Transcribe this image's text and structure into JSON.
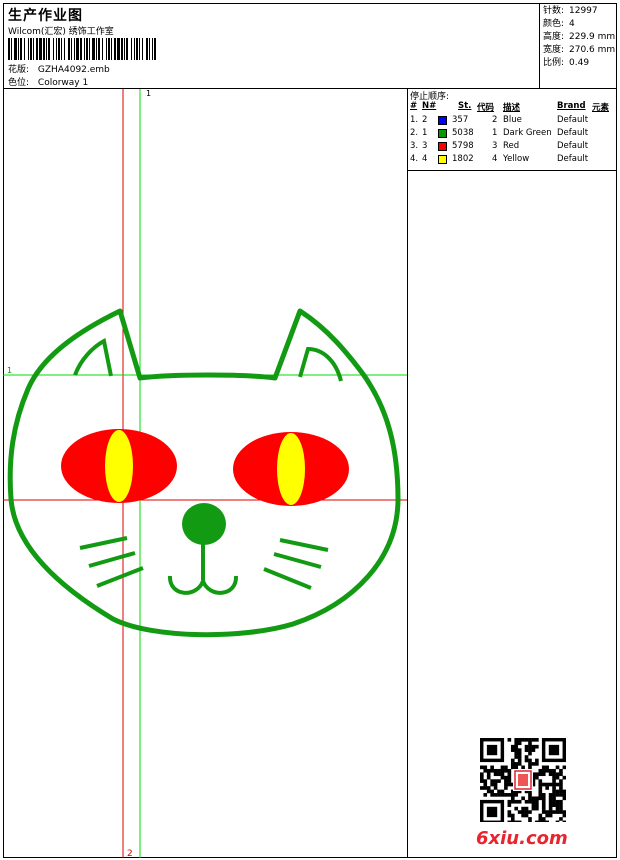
{
  "header": {
    "title": "生产作业图",
    "subtitle": "Wilcom(汇宏) 绣饰工作室",
    "design_label": "花版:",
    "design_value": "GZHA4092.emb",
    "colorway_label": "色位:",
    "colorway_value": "Colorway 1"
  },
  "stats": {
    "stitches_label": "针数:",
    "stitches_value": "12997",
    "colors_label": "颜色:",
    "colors_value": "4",
    "height_label": "高度:",
    "height_value": "229.9 mm",
    "width_label": "宽度:",
    "width_value": "270.6 mm",
    "scale_label": "比例:",
    "scale_value": "0.49"
  },
  "guides": {
    "green_vertical_label": "1",
    "green_horizontal_label": "1",
    "red_vertical_label": "2"
  },
  "stop_sequence": {
    "title": "停止顺序:",
    "headers": {
      "num": "#",
      "n": "N#",
      "stitches": "St.",
      "code": "代码",
      "desc": "描述",
      "brand": "Brand",
      "element": "元素"
    },
    "rows": [
      {
        "num": "1.",
        "n": "2",
        "color": "#0000ff",
        "stitches": "357",
        "code": "2",
        "desc": "Blue",
        "brand": "Default"
      },
      {
        "num": "2.",
        "n": "1",
        "color": "#009900",
        "stitches": "5038",
        "code": "1",
        "desc": "Dark Green",
        "brand": "Default"
      },
      {
        "num": "3.",
        "n": "3",
        "color": "#ff0000",
        "stitches": "5798",
        "code": "3",
        "desc": "Red",
        "brand": "Default"
      },
      {
        "num": "4.",
        "n": "4",
        "color": "#ffff00",
        "stitches": "1802",
        "code": "4",
        "desc": "Yellow",
        "brand": "Default"
      }
    ]
  },
  "colors": {
    "outline_green": "#139a13",
    "eye_red": "#ff0000",
    "eye_yellow": "#ffff00",
    "guide_green": "#00dd00",
    "guide_red": "#dd0000",
    "watermark_red": "#e8252f"
  },
  "watermark": "6xiu.com"
}
